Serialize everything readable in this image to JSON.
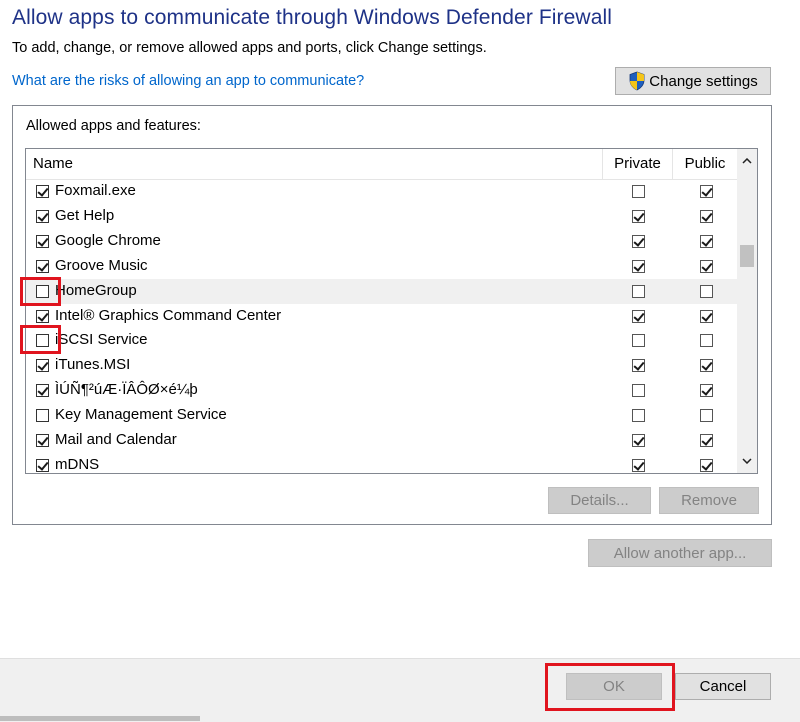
{
  "header": {
    "title": "Allow apps to communicate through Windows Defender Firewall",
    "subtitle": "To add, change, or remove allowed apps and ports, click Change settings.",
    "risk_link": "What are the risks of allowing an app to communicate?",
    "change_settings": "Change settings"
  },
  "group": {
    "label": "Allowed apps and features:",
    "columns": {
      "name": "Name",
      "private": "Private",
      "public": "Public"
    },
    "scroll_up": "˄",
    "scroll_down": "˅"
  },
  "apps": [
    {
      "name": "Foxmail.exe",
      "enabled": true,
      "private": false,
      "public": true
    },
    {
      "name": "Get Help",
      "enabled": true,
      "private": true,
      "public": true
    },
    {
      "name": "Google Chrome",
      "enabled": true,
      "private": true,
      "public": true
    },
    {
      "name": "Groove Music",
      "enabled": true,
      "private": true,
      "public": true
    },
    {
      "name": "HomeGroup",
      "enabled": false,
      "private": false,
      "public": false
    },
    {
      "name": "Intel® Graphics Command Center",
      "enabled": true,
      "private": true,
      "public": true
    },
    {
      "name": "iSCSI Service",
      "enabled": false,
      "private": false,
      "public": false
    },
    {
      "name": "iTunes.MSI",
      "enabled": true,
      "private": true,
      "public": true
    },
    {
      "name": "ÌÚÑ¶²úÆ·ÏÂÔØ×é¼þ",
      "enabled": true,
      "private": false,
      "public": true
    },
    {
      "name": "Key Management Service",
      "enabled": false,
      "private": false,
      "public": false
    },
    {
      "name": "Mail and Calendar",
      "enabled": true,
      "private": true,
      "public": true
    },
    {
      "name": "mDNS",
      "enabled": true,
      "private": true,
      "public": true
    }
  ],
  "buttons": {
    "details": "Details...",
    "remove": "Remove",
    "allow_another": "Allow another app...",
    "ok": "OK",
    "cancel": "Cancel"
  },
  "colors": {
    "title": "#1e3287",
    "link": "#0066cc",
    "highlight": "#e0141e"
  }
}
